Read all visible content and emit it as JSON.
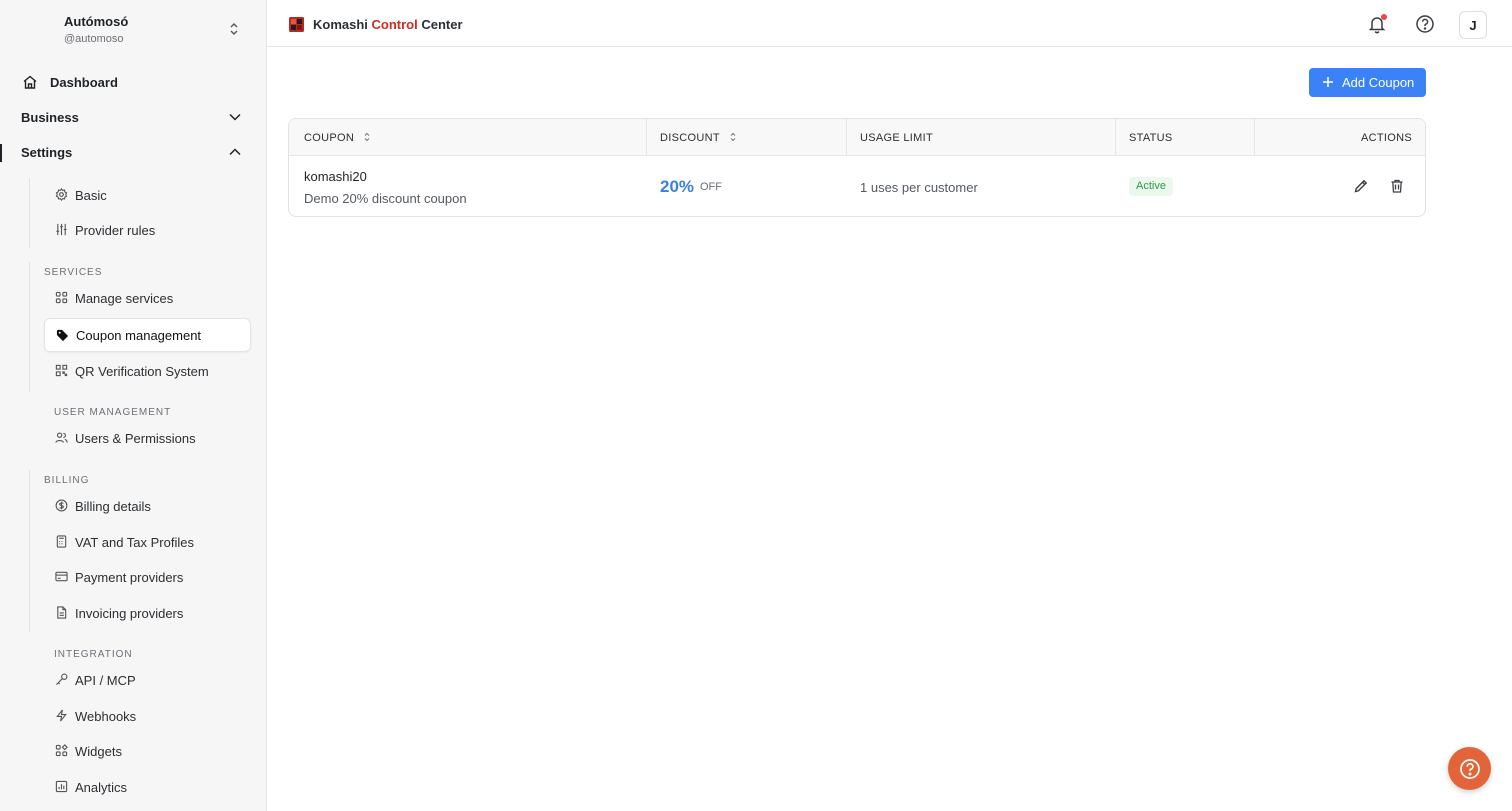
{
  "org": {
    "name": "Autómosó",
    "handle": "@automoso"
  },
  "nav": {
    "dashboard": "Dashboard",
    "business": "Business",
    "settings": "Settings",
    "basic": "Basic",
    "provider_rules": "Provider rules",
    "services_label": "SERVICES",
    "manage_services": "Manage services",
    "coupon_management": "Coupon management",
    "qr_verification": "QR Verification System",
    "user_mgmt_label": "USER MANAGEMENT",
    "users_permissions": "Users & Permissions",
    "billing_label": "BILLING",
    "billing_details": "Billing details",
    "vat_tax": "VAT and Tax Profiles",
    "payment_providers": "Payment providers",
    "invoicing_providers": "Invoicing providers",
    "integration_label": "INTEGRATION",
    "api_mcp": "API / MCP",
    "webhooks": "Webhooks",
    "widgets": "Widgets",
    "analytics": "Analytics"
  },
  "header": {
    "brand_pre": "Komashi ",
    "brand_mid": "Control",
    "brand_post": " Center",
    "avatar_initial": "J",
    "colors": {
      "brand_red": "#d42a20",
      "accent": "#3b82f6"
    }
  },
  "actions": {
    "add_coupon": "Add Coupon"
  },
  "table": {
    "columns": [
      "COUPON",
      "DISCOUNT",
      "USAGE LIMIT",
      "STATUS",
      "ACTIONS"
    ],
    "rows": [
      {
        "code": "komashi20",
        "description": "Demo 20% discount coupon",
        "discount_value": "20%",
        "discount_suffix": "OFF",
        "usage_limit": "1 uses per customer",
        "status": "Active"
      }
    ]
  }
}
